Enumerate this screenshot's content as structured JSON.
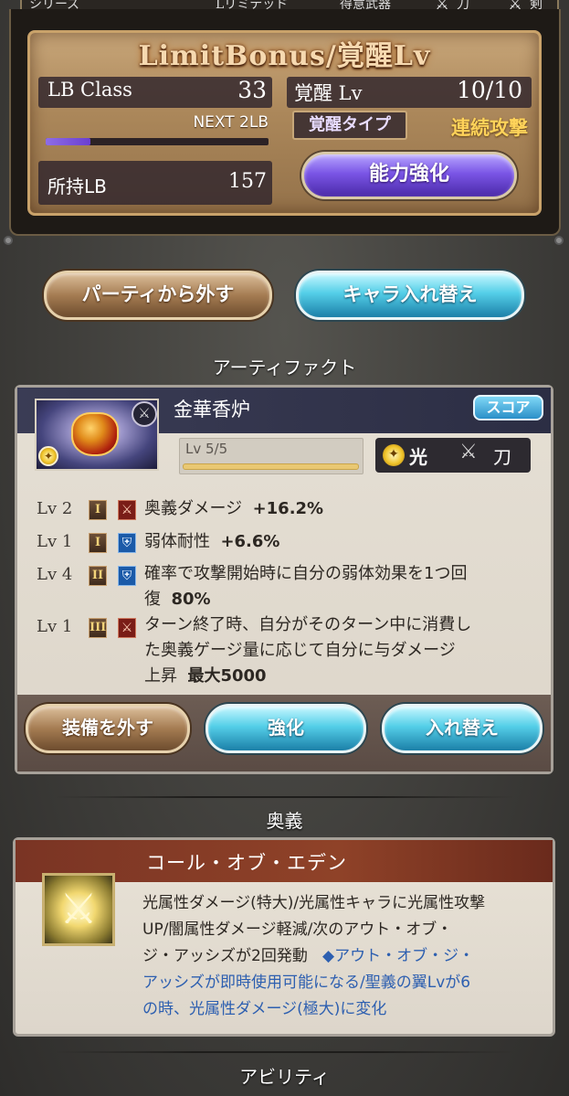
{
  "top_strip": {
    "left_text": "シリーズ",
    "middle_text": "Lリミテッド",
    "right_text": "得意武器",
    "w1": "刀",
    "w2": "剣"
  },
  "limit_bonus": {
    "title": "LimitBonus/覚醒Lv",
    "lb_class_label": "LB Class",
    "lb_class_value": "33",
    "next_text": "NEXT 2LB",
    "progress_fraction": 0.2,
    "held_label": "所持LB",
    "held_value": "157",
    "awaken_label": "覚醒 Lv",
    "awaken_value": "10/10",
    "awaken_type_label": "覚醒タイプ",
    "awaken_type_value": "連続攻撃",
    "enhance_button": "能力強化"
  },
  "party_buttons": {
    "remove": "パーティから外す",
    "swap": "キャラ入れ替え"
  },
  "artifact": {
    "section_title": "アーティファクト",
    "name": "金華香炉",
    "score_button": "スコア",
    "level_text": "Lv 5/5",
    "level_fraction": 1.0,
    "element_label": "光",
    "weapon_label": "刀",
    "skills": [
      {
        "lv": "Lv 2",
        "rank": "I",
        "type": "attack",
        "line1": "奥義ダメージ",
        "bold": "+16.2%"
      },
      {
        "lv": "Lv 1",
        "rank": "I",
        "type": "defense",
        "line1": "弱体耐性",
        "bold": "+6.6%"
      },
      {
        "lv": "Lv 4",
        "rank": "II",
        "type": "defense",
        "line1": "確率で攻撃開始時に自分の弱体効果を1つ回",
        "line2": "復",
        "bold": "80%"
      },
      {
        "lv": "Lv 1",
        "rank": "III",
        "type": "attack",
        "line1": "ターン終了時、自分がそのターン中に消費し",
        "line2": "た奥義ゲージ量に応じて自分に与ダメージ",
        "line3": "上昇",
        "bold": "最大5000"
      }
    ],
    "buttons": {
      "unequip": "装備を外す",
      "enhance": "強化",
      "replace": "入れ替え"
    }
  },
  "ougi": {
    "section_title": "奥義",
    "name": "コール・オブ・エデン",
    "desc_line1": "光属性ダメージ(特大)/光属性キャラに光属性攻撃",
    "desc_line2": "UP/闇属性ダメージ軽減/次のアウト・オブ・",
    "desc_line3a": "ジ・アッシズが2回発動",
    "desc_line3b": "◆アウト・オブ・ジ・",
    "desc_line4": "アッシズが即時使用可能になる/聖義の翼Lvが6",
    "desc_line5": "の時、光属性ダメージ(極大)に変化"
  },
  "ability": {
    "section_title": "アビリティ"
  },
  "colors": {
    "accent_gold": "#ffd35a",
    "purple_button": "#7a55e6",
    "blue_button": "#54cfe8",
    "brown_button": "#a57c52",
    "ougi_header": "#8f4228",
    "ougi_blue_text": "#2d5fb0"
  }
}
